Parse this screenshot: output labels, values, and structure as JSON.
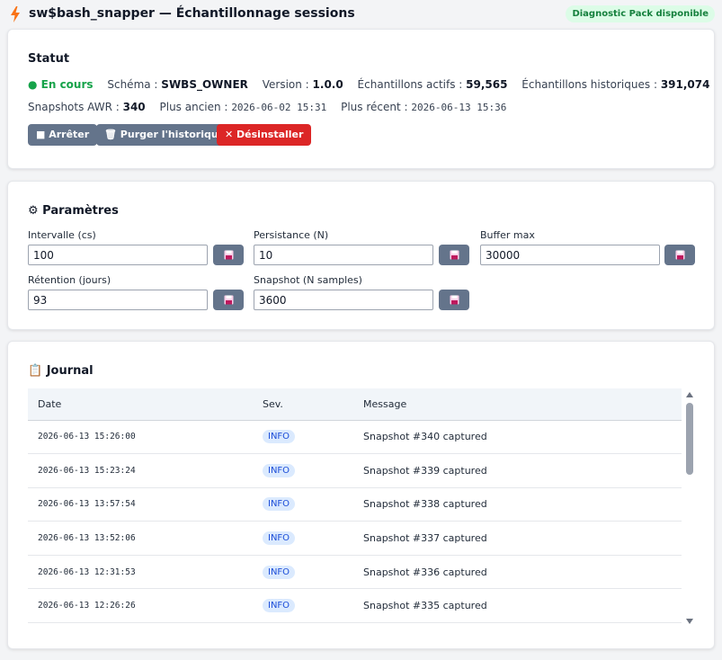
{
  "header": {
    "title": "sw$bash_snapper — Échantillonnage sessions",
    "badge": "Diagnostic Pack disponible"
  },
  "status": {
    "title": "Statut",
    "state": "● En cours",
    "schema_label": "Schéma :",
    "schema_value": "SWBS_OWNER",
    "version_label": "Version :",
    "version_value": "1.0.0",
    "active_label": "Échantillons actifs :",
    "active_value": "59,565",
    "history_label": "Échantillons historiques :",
    "history_value": "391,074",
    "awr_label": "Snapshots AWR :",
    "awr_value": "340",
    "oldest_label": "Plus ancien :",
    "oldest_value": "2026-06-02 15:31",
    "newest_label": "Plus récent :",
    "newest_value": "2026-06-13 15:36",
    "buttons": {
      "stop": "■ Arrêter",
      "purge": "🗑 Purger l'historique",
      "uninstall": "✕ Désinstaller"
    },
    "colors": {
      "running": "#16a34a",
      "danger": "#dc2626",
      "button": "#64748b"
    }
  },
  "params": {
    "title": "⚙ Paramètres",
    "fields": [
      {
        "label": "Intervalle (cs)",
        "value": "100"
      },
      {
        "label": "Persistance (N)",
        "value": "10"
      },
      {
        "label": "Buffer max",
        "value": "30000"
      },
      {
        "label": "Rétention (jours)",
        "value": "93"
      },
      {
        "label": "Snapshot (N samples)",
        "value": "3600"
      }
    ],
    "save_icon": "floppy-disk-icon"
  },
  "journal": {
    "title": "📋 Journal",
    "columns": [
      "Date",
      "Sev.",
      "Message"
    ],
    "rows": [
      {
        "date": "2026-06-13 15:26:00",
        "sev": "INFO",
        "message": "Snapshot #340 captured"
      },
      {
        "date": "2026-06-13 15:23:24",
        "sev": "INFO",
        "message": "Snapshot #339 captured"
      },
      {
        "date": "2026-06-13 13:57:54",
        "sev": "INFO",
        "message": "Snapshot #338 captured"
      },
      {
        "date": "2026-06-13 13:52:06",
        "sev": "INFO",
        "message": "Snapshot #337 captured"
      },
      {
        "date": "2026-06-13 12:31:53",
        "sev": "INFO",
        "message": "Snapshot #336 captured"
      },
      {
        "date": "2026-06-13 12:26:26",
        "sev": "INFO",
        "message": "Snapshot #335 captured"
      },
      {
        "date": "",
        "sev": "",
        "message": ""
      }
    ]
  }
}
